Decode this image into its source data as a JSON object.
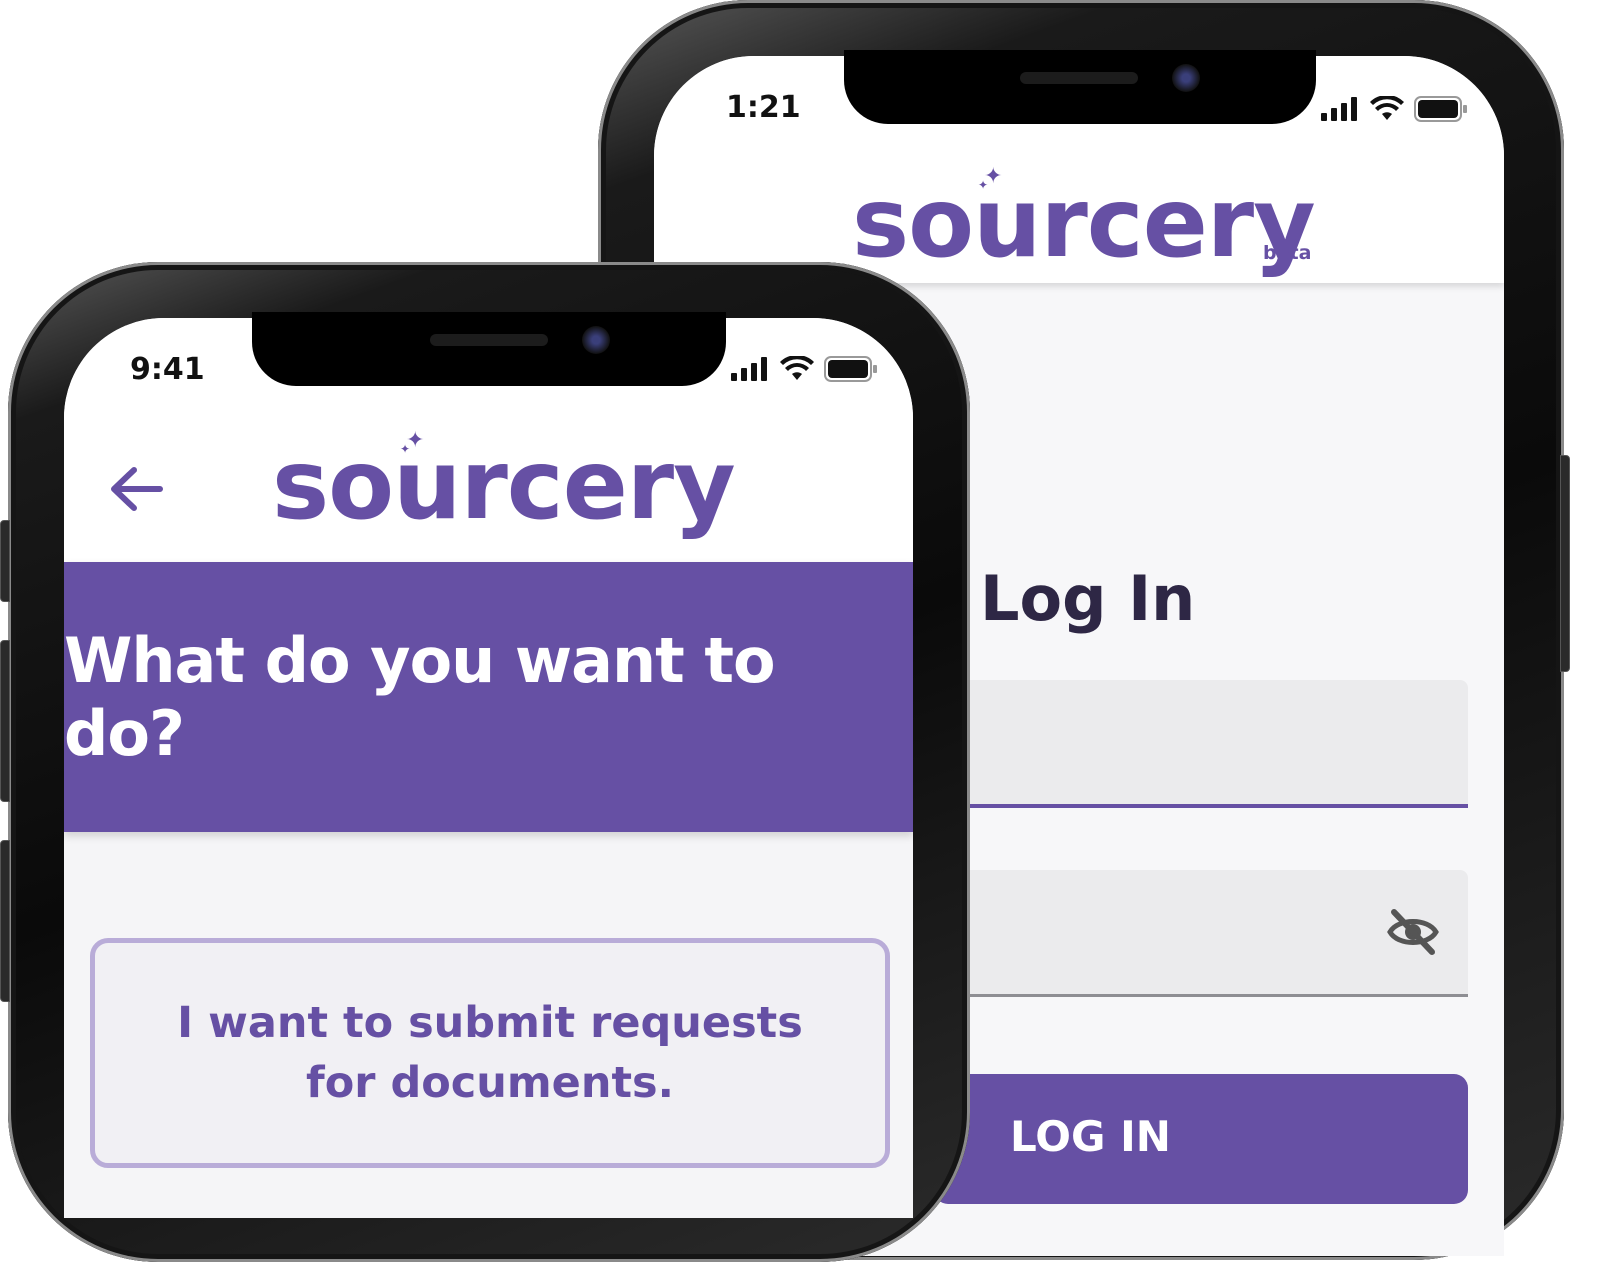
{
  "back_phone": {
    "status_bar": {
      "time": "1:21"
    },
    "header": {
      "logo_text": "sourcery",
      "logo_badge": "beta"
    },
    "login": {
      "title": "Log In",
      "button_label": "LOG IN"
    },
    "colors": {
      "brand": "#6650a4",
      "field_bg": "#ebebed"
    },
    "icons": [
      "cellular-signal-icon",
      "wifi-icon",
      "battery-icon",
      "eye-off-icon",
      "sparkle-icon"
    ]
  },
  "front_phone": {
    "status_bar": {
      "time": "9:41"
    },
    "header": {
      "logo_text": "sourcery"
    },
    "banner": {
      "question": "What do you want to do?"
    },
    "options": [
      {
        "label": "I want to submit requests for documents."
      }
    ],
    "colors": {
      "brand": "#6650a4",
      "card_border": "#b9acd8"
    },
    "icons": [
      "back-arrow-icon",
      "cellular-signal-icon",
      "wifi-icon",
      "battery-icon",
      "sparkle-icon"
    ]
  }
}
